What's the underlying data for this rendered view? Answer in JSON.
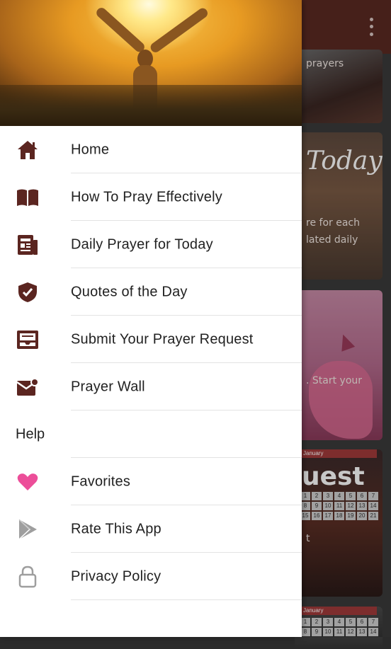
{
  "colors": {
    "drawer_icon": "#5b2520",
    "favorites_icon": "#ec4e99",
    "gray_icon": "#9e9e9e",
    "toolbar": "#5a2a22"
  },
  "background": {
    "card1_text": "prayers",
    "card2_title": "Today",
    "card2_line1": "re for each",
    "card2_line2": "lated daily",
    "card3_text": ". Start your",
    "card4_title": "uest",
    "card4_month": "January",
    "card4_suffix": "t",
    "card5_month": "January",
    "calendar_days": [
      "1",
      "2",
      "3",
      "4",
      "5",
      "6",
      "7",
      "8",
      "9",
      "10",
      "11",
      "12",
      "13",
      "14",
      "15",
      "16",
      "17",
      "18",
      "19",
      "20",
      "21"
    ]
  },
  "drawer": {
    "items": [
      {
        "label": "Home",
        "icon": "home-icon"
      },
      {
        "label": "How To Pray Effectively",
        "icon": "book-icon"
      },
      {
        "label": "Daily Prayer for Today",
        "icon": "newspaper-icon"
      },
      {
        "label": "Quotes of the Day",
        "icon": "shield-check-icon"
      },
      {
        "label": "Submit Your Prayer Request",
        "icon": "inbox-icon"
      },
      {
        "label": "Prayer Wall",
        "icon": "mail-notification-icon"
      }
    ],
    "help_section": "Help",
    "help_items": [
      {
        "label": "Favorites",
        "icon": "heart-icon"
      },
      {
        "label": "Rate This App",
        "icon": "play-store-icon"
      },
      {
        "label": "Privacy Policy",
        "icon": "lock-icon"
      }
    ]
  }
}
